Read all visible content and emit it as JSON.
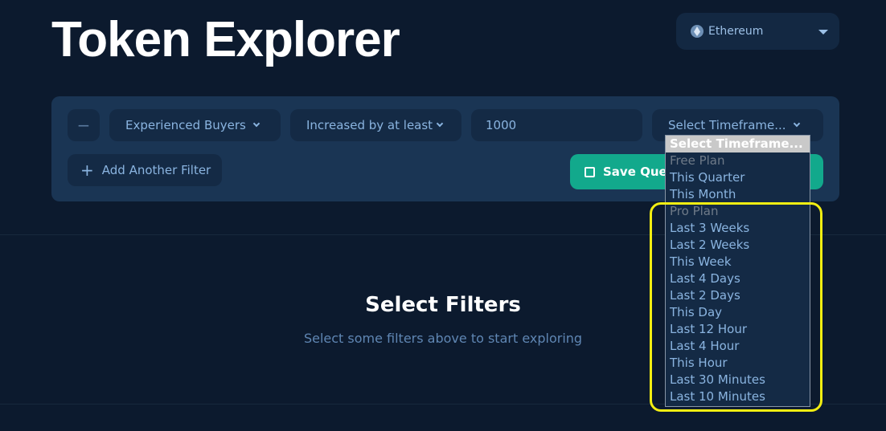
{
  "header": {
    "title": "Token Explorer",
    "network": {
      "label": "Ethereum",
      "icon": "ethereum-icon"
    }
  },
  "filter": {
    "remove_label": "−",
    "metric": "Experienced Buyers",
    "condition": "Increased by at least",
    "value": "1000",
    "timeframe": "Select Timeframe...",
    "add_label": "Add Another Filter",
    "save_label": "Save Query"
  },
  "empty": {
    "title": "Select Filters",
    "subtitle": "Select some filters above to start exploring"
  },
  "timeframe_options": [
    {
      "label": "Select Timeframe...",
      "type": "selected"
    },
    {
      "label": "Free Plan",
      "type": "group"
    },
    {
      "label": "This Quarter"
    },
    {
      "label": "This Month"
    },
    {
      "label": "Pro Plan",
      "type": "group"
    },
    {
      "label": "Last 3 Weeks"
    },
    {
      "label": "Last 2 Weeks"
    },
    {
      "label": "This Week"
    },
    {
      "label": "Last 4 Days"
    },
    {
      "label": "Last 2 Days"
    },
    {
      "label": "This Day"
    },
    {
      "label": "Last 12 Hour"
    },
    {
      "label": "Last 4 Hour"
    },
    {
      "label": "This Hour"
    },
    {
      "label": "Last 30 Minutes"
    },
    {
      "label": "Last 10 Minutes"
    }
  ],
  "colors": {
    "background": "#0c1a2e",
    "panel": "#1a3554",
    "accent": "#12a98c",
    "highlight": "#f2ee12"
  }
}
